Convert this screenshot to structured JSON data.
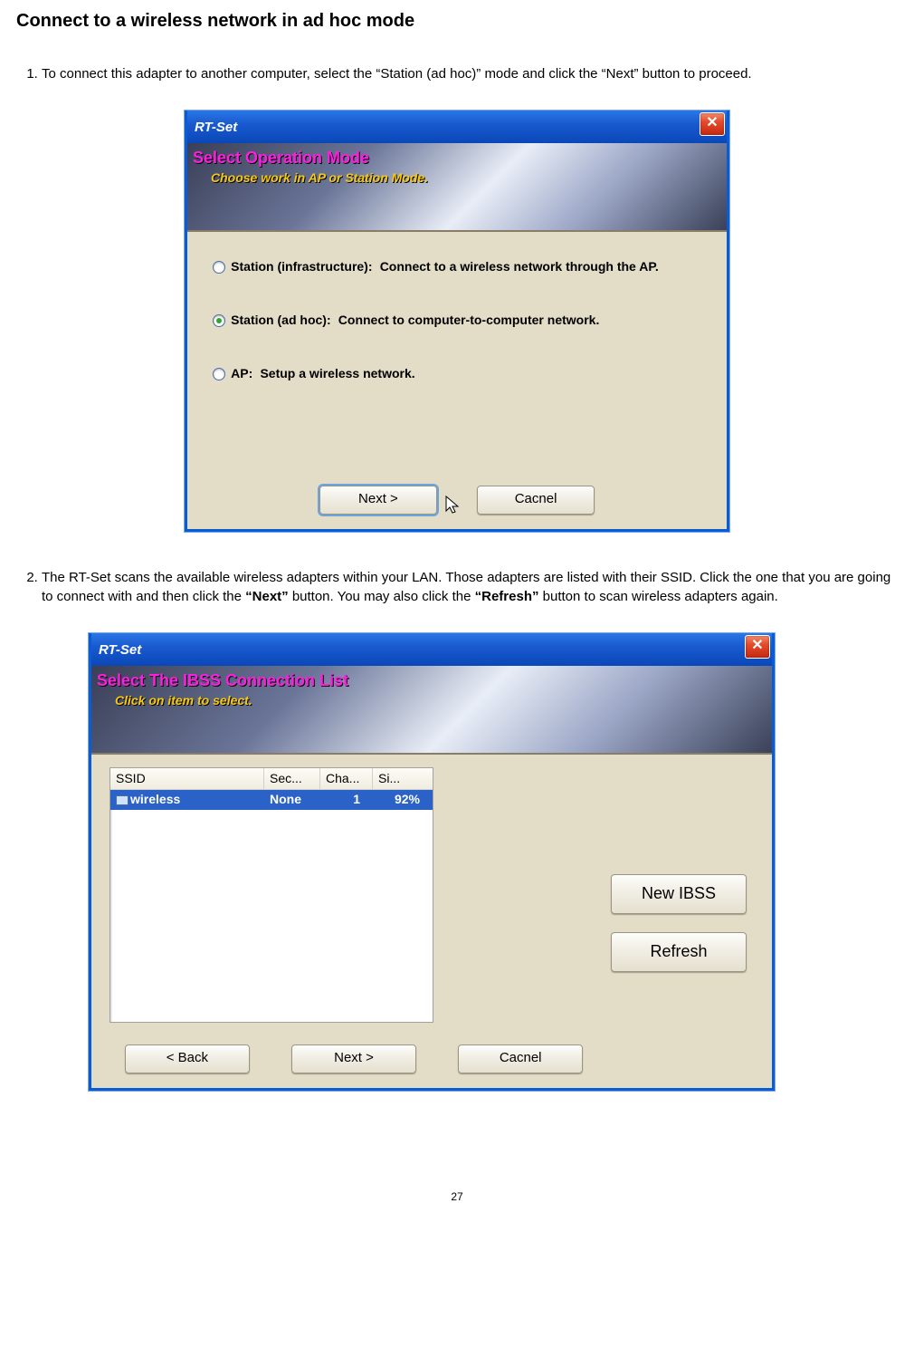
{
  "page": {
    "heading": "Connect to a wireless network in ad hoc mode",
    "step1_pre": "To connect this adapter to another computer, select the “Station (ad hoc)” mode and click the “Next” button to proceed.",
    "step2_pre": "The RT-Set scans the available wireless adapters within your LAN. Those adapters are listed with their SSID. Click the one that you are going to connect with and then click the ",
    "step2_bold1": "“Next”",
    "step2_mid": " button. You may also click the ",
    "step2_bold2": "“Refresh”",
    "step2_post": " button to scan wireless adapters again.",
    "pagenum": "27"
  },
  "dialog1": {
    "title": "RT-Set",
    "banner_title": "Select Operation Mode",
    "banner_sub": "Choose work in AP or Station Mode.",
    "opt1_label": "Station (infrastructure):",
    "opt1_desc": "Connect to a wireless network through the AP.",
    "opt2_label": "Station (ad hoc):",
    "opt2_desc": "Connect to computer-to-computer network.",
    "opt3_label": "AP:",
    "opt3_desc": "Setup a wireless network.",
    "next": "Next >",
    "cancel": "Cacnel"
  },
  "dialog2": {
    "title": "RT-Set",
    "banner_title": "Select The IBSS Connection List",
    "banner_sub": "Click on item to select.",
    "col_ssid": "SSID",
    "col_sec": "Sec...",
    "col_cha": "Cha...",
    "col_si": "Si...",
    "row_ssid": "wireless",
    "row_sec": "None",
    "row_cha": "1",
    "row_si": "92%",
    "newibss": "New IBSS",
    "refresh": "Refresh",
    "back": "< Back",
    "next": "Next >",
    "cancel": "Cacnel"
  }
}
